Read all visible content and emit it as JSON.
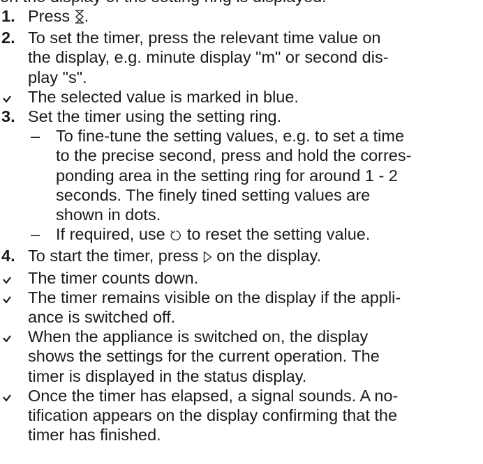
{
  "top_line": "on the display of the setting ring is displayed.",
  "steps": {
    "s1": {
      "num": "1.",
      "pre": "Press ",
      "post": "."
    },
    "s2": {
      "num": "2.",
      "lines": [
        "To set the timer, press the relevant time value on",
        "the display, e.g. minute display \"m\" or second dis-",
        "play \"s\"."
      ]
    },
    "r1": {
      "text": "The selected value is marked in blue."
    },
    "s3": {
      "num": "3.",
      "text": "Set the timer using the setting ring."
    },
    "sub1": {
      "dash": "–",
      "lines": [
        "To fine-tune the setting values, e.g. to set a time",
        "to the precise second, press and hold the corres-",
        "ponding area in the setting ring for around 1 - 2",
        "seconds. The finely tined setting values are",
        "shown in dots."
      ]
    },
    "sub2": {
      "dash": "–",
      "pre": "If required, use ",
      "post": " to reset the setting value."
    },
    "s4": {
      "num": "4.",
      "pre": "To start the timer, press ",
      "post": " on the display."
    },
    "r2": {
      "text": "The timer counts down."
    },
    "r3": {
      "lines": [
        "The timer remains visible on the display if the appli-",
        "ance is switched off."
      ]
    },
    "r4": {
      "lines": [
        "When the appliance is switched on, the display",
        "shows the settings for the current operation. The",
        "timer is displayed in the status display."
      ]
    },
    "r5": {
      "lines": [
        "Once the timer has elapsed, a signal sounds. A no-",
        "tification appears on the display confirming that the",
        "timer has finished."
      ]
    }
  },
  "icons": {
    "timer": "hourglass-icon",
    "reset": "reset-icon",
    "start": "play-icon",
    "result": "checkmark-icon"
  },
  "colors": {
    "text": "#1a1a1a"
  }
}
